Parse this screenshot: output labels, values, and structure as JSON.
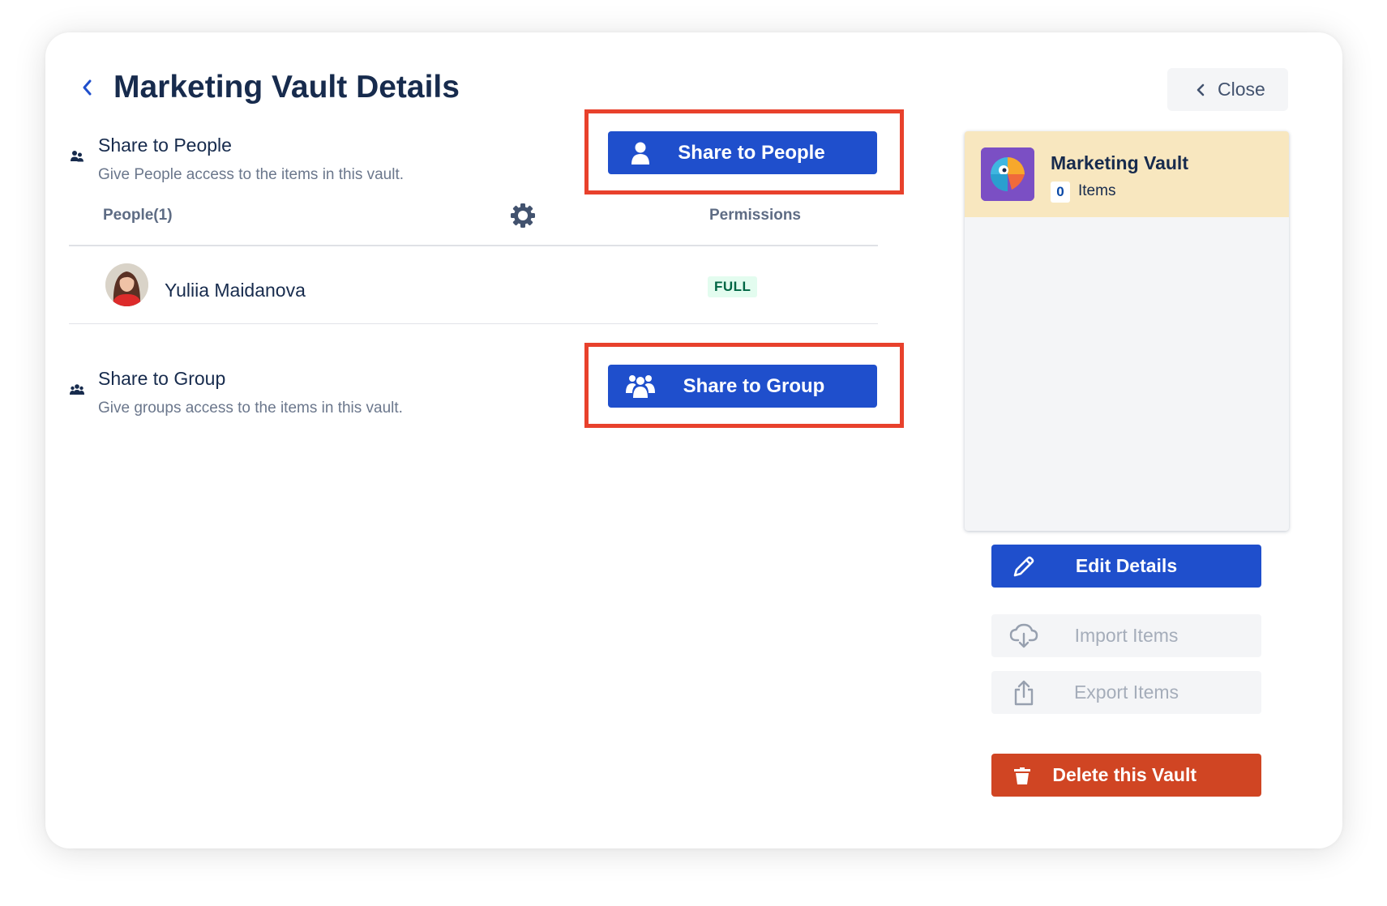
{
  "header": {
    "title": "Marketing Vault Details",
    "close_label": "Close"
  },
  "share_people": {
    "title": "Share to People",
    "description": "Give People access to the items in this vault.",
    "button_label": "Share to People"
  },
  "people_table": {
    "col_people": "People(1)",
    "col_permissions": "Permissions",
    "rows": [
      {
        "name": "Yuliia Maidanova",
        "permission": "FULL"
      }
    ]
  },
  "share_group": {
    "title": "Share to Group",
    "description": "Give groups access to the items in this vault.",
    "button_label": "Share to Group"
  },
  "vault": {
    "name": "Marketing Vault",
    "item_count": "0",
    "items_label": "Items"
  },
  "actions": {
    "edit_label": "Edit Details",
    "import_label": "Import Items",
    "export_label": "Export Items",
    "delete_label": "Delete this Vault"
  },
  "colors": {
    "primary": "#1f4fcc",
    "danger": "#d04523",
    "highlight": "#e8412c",
    "vault_header": "#f8e7bf",
    "badge_bg": "#e3fcef"
  },
  "icons": [
    "chevron-left-icon",
    "people-icon",
    "user-icon",
    "group-icon",
    "gear-icon",
    "pencil-icon",
    "cloud-download-icon",
    "share-upload-icon",
    "trash-icon"
  ]
}
